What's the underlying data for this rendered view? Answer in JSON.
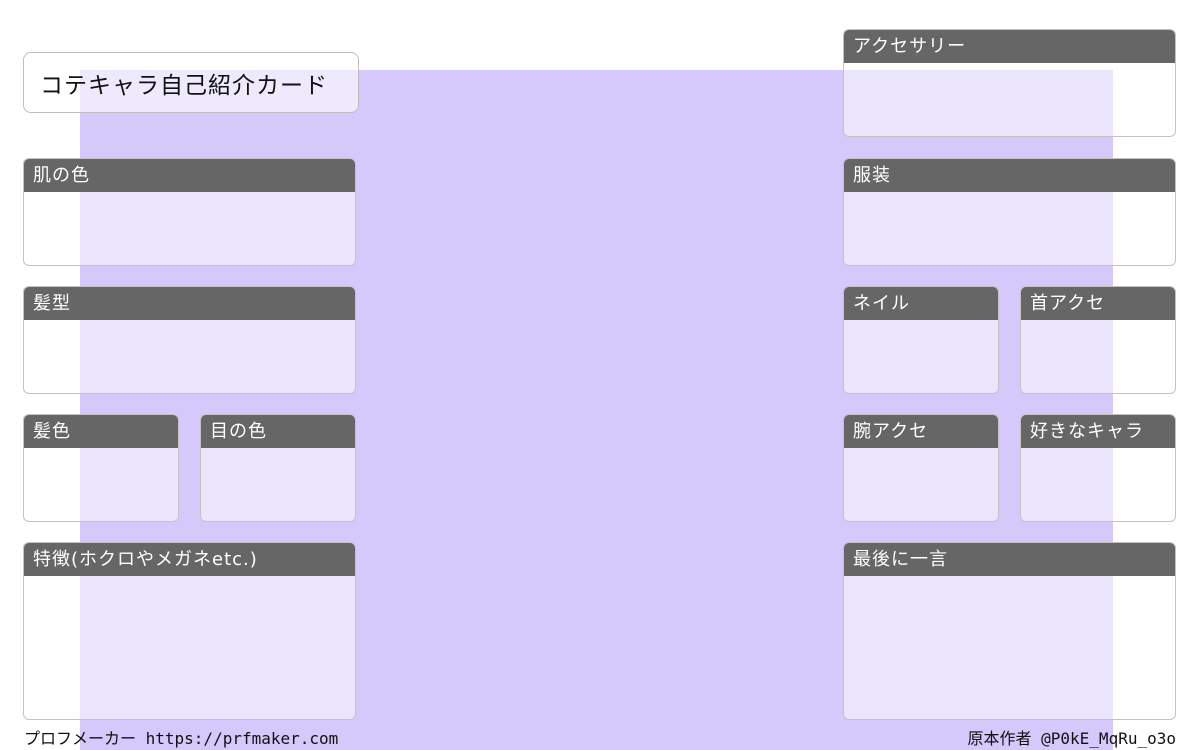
{
  "title": "コテキャラ自己紹介カード",
  "panels": {
    "skin": "肌の色",
    "hairstyle": "髪型",
    "hair_color": "髪色",
    "eye_color": "目の色",
    "features": "特徴(ホクロやメガネetc.)",
    "accessory": "アクセサリー",
    "clothing": "服装",
    "nail": "ネイル",
    "neck_accessory": "首アクセ",
    "arm_accessory": "腕アクセ",
    "favorite_chara": "好きなキャラ",
    "last_word": "最後に一言"
  },
  "footer": {
    "left": "プロフメーカー https://prfmaker.com",
    "right": "原本作者 @P0kE_MqRu_o3o"
  },
  "colors": {
    "background_accent": "#d5c8fb",
    "header": "#666666"
  }
}
